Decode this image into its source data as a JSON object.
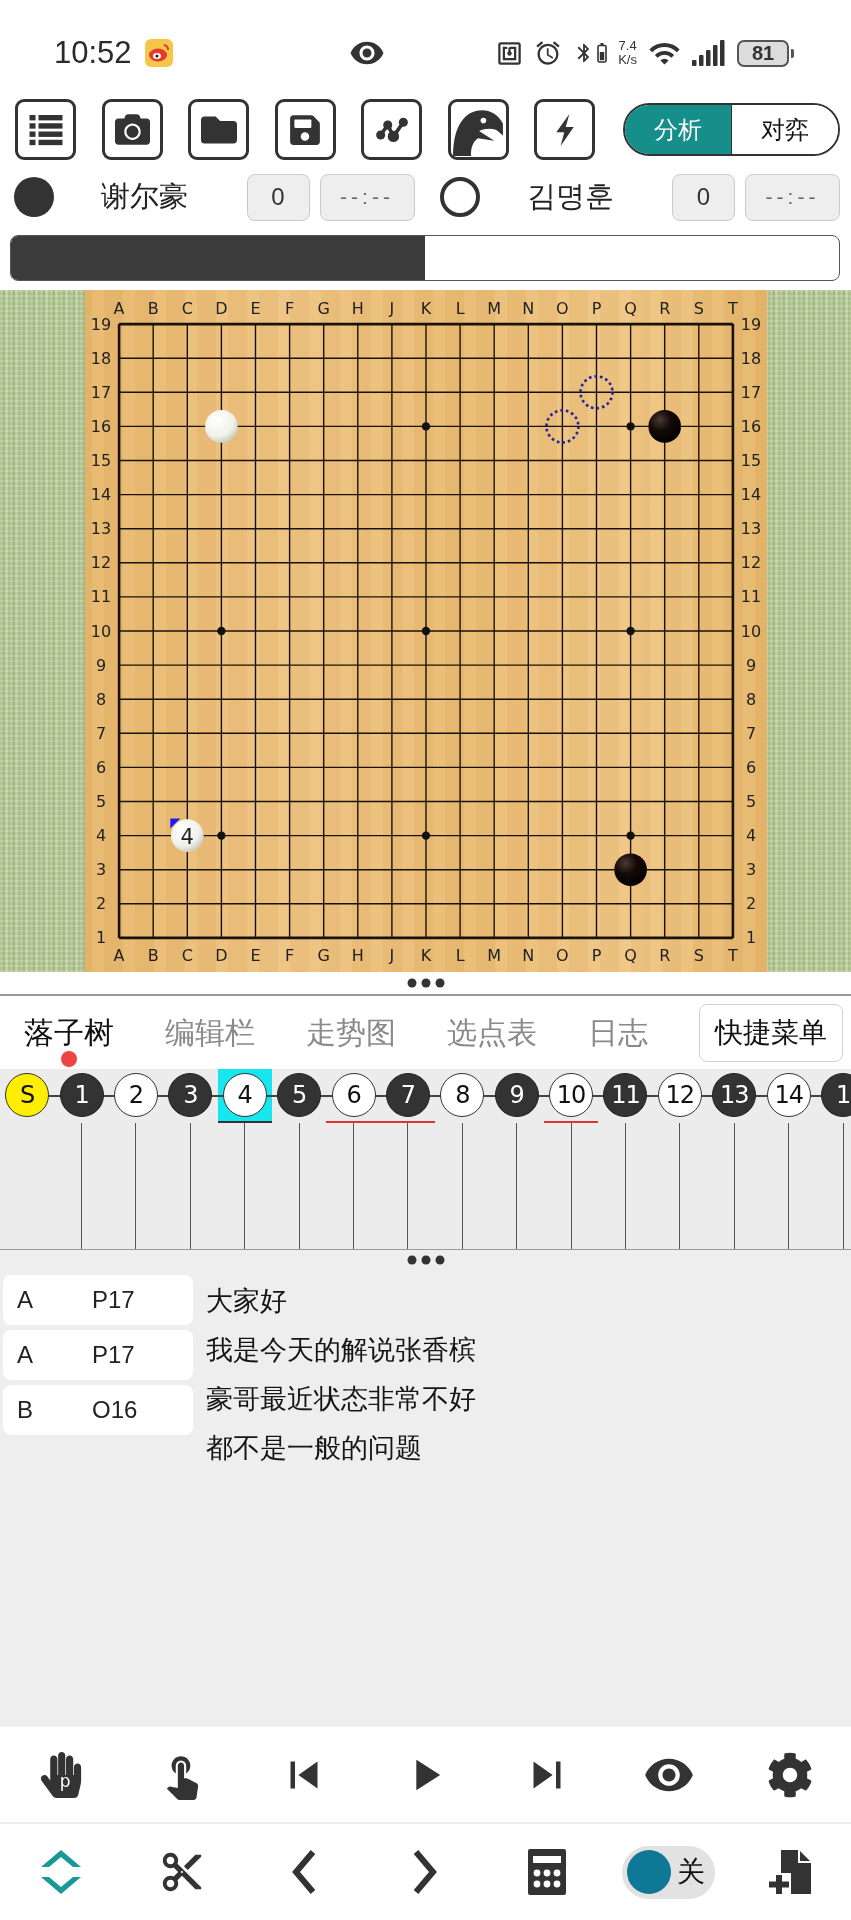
{
  "status_bar": {
    "time": "10:52",
    "network_speed": {
      "value": "7.4",
      "unit": "K/s"
    },
    "battery": "81"
  },
  "mode_switch": [
    {
      "label": "分析",
      "selected": true
    },
    {
      "label": "对弈",
      "selected": false
    }
  ],
  "players": [
    {
      "kind": "black",
      "name": "谢尔豪",
      "captures": "0",
      "clock": "--:--"
    },
    {
      "kind": "white",
      "name": "김명훈",
      "captures": "0",
      "clock": "--:--"
    }
  ],
  "win_rate_bar": {
    "level": 0.5
  },
  "board": {
    "columns_top": [
      "A",
      "B",
      "C",
      "D",
      "E",
      "F",
      "G",
      "H",
      "J",
      "K",
      "L",
      "M",
      "N",
      "O",
      "P",
      "Q",
      "R",
      "S",
      "T"
    ],
    "columns_bottom": [
      "A",
      "B",
      "C",
      "D",
      "E",
      "F",
      "G",
      "H",
      "J",
      "K",
      "L",
      "M",
      "N",
      "O",
      "P",
      "Q",
      "R",
      "S",
      "T"
    ],
    "rows": [
      {
        "left_label": "19",
        "right_label": "19",
        "points": [
          {
            "kind": "empty"
          },
          {
            "kind": "empty"
          },
          {
            "kind": "empty"
          },
          {
            "kind": "empty"
          },
          {
            "kind": "empty"
          },
          {
            "kind": "empty"
          },
          {
            "kind": "empty"
          },
          {
            "kind": "empty"
          },
          {
            "kind": "empty"
          },
          {
            "kind": "empty"
          },
          {
            "kind": "empty"
          },
          {
            "kind": "empty"
          },
          {
            "kind": "empty"
          },
          {
            "kind": "empty"
          },
          {
            "kind": "empty"
          },
          {
            "kind": "empty"
          },
          {
            "kind": "empty"
          },
          {
            "kind": "empty"
          },
          {
            "kind": "empty"
          }
        ]
      },
      {
        "left_label": "18",
        "right_label": "18",
        "points": [
          {
            "kind": "empty"
          },
          {
            "kind": "empty"
          },
          {
            "kind": "empty"
          },
          {
            "kind": "empty"
          },
          {
            "kind": "empty"
          },
          {
            "kind": "empty"
          },
          {
            "kind": "empty"
          },
          {
            "kind": "empty"
          },
          {
            "kind": "empty"
          },
          {
            "kind": "empty"
          },
          {
            "kind": "empty"
          },
          {
            "kind": "empty"
          },
          {
            "kind": "empty"
          },
          {
            "kind": "empty"
          },
          {
            "kind": "empty"
          },
          {
            "kind": "empty"
          },
          {
            "kind": "empty"
          },
          {
            "kind": "empty"
          },
          {
            "kind": "empty"
          }
        ]
      },
      {
        "left_label": "17",
        "right_label": "17",
        "points": [
          {
            "kind": "empty"
          },
          {
            "kind": "empty"
          },
          {
            "kind": "empty"
          },
          {
            "kind": "empty"
          },
          {
            "kind": "empty"
          },
          {
            "kind": "empty"
          },
          {
            "kind": "empty"
          },
          {
            "kind": "empty"
          },
          {
            "kind": "empty"
          },
          {
            "kind": "empty"
          },
          {
            "kind": "empty"
          },
          {
            "kind": "empty"
          },
          {
            "kind": "empty"
          },
          {
            "kind": "empty"
          },
          {
            "kind": "candidate"
          },
          {
            "kind": "empty"
          },
          {
            "kind": "empty"
          },
          {
            "kind": "empty"
          },
          {
            "kind": "empty"
          }
        ]
      },
      {
        "left_label": "16",
        "right_label": "16",
        "points": [
          {
            "kind": "empty"
          },
          {
            "kind": "empty"
          },
          {
            "kind": "empty"
          },
          {
            "kind": "white",
            "last_move": false
          },
          {
            "kind": "empty"
          },
          {
            "kind": "empty"
          },
          {
            "kind": "empty"
          },
          {
            "kind": "empty"
          },
          {
            "kind": "empty"
          },
          {
            "kind": "empty"
          },
          {
            "kind": "empty"
          },
          {
            "kind": "empty"
          },
          {
            "kind": "empty"
          },
          {
            "kind": "candidate"
          },
          {
            "kind": "empty"
          },
          {
            "kind": "empty"
          },
          {
            "kind": "black",
            "last_move": false
          },
          {
            "kind": "empty"
          },
          {
            "kind": "empty"
          }
        ]
      },
      {
        "left_label": "15",
        "right_label": "15",
        "points": [
          {
            "kind": "empty"
          },
          {
            "kind": "empty"
          },
          {
            "kind": "empty"
          },
          {
            "kind": "empty"
          },
          {
            "kind": "empty"
          },
          {
            "kind": "empty"
          },
          {
            "kind": "empty"
          },
          {
            "kind": "empty"
          },
          {
            "kind": "empty"
          },
          {
            "kind": "empty"
          },
          {
            "kind": "empty"
          },
          {
            "kind": "empty"
          },
          {
            "kind": "empty"
          },
          {
            "kind": "empty"
          },
          {
            "kind": "empty"
          },
          {
            "kind": "empty"
          },
          {
            "kind": "empty"
          },
          {
            "kind": "empty"
          },
          {
            "kind": "empty"
          }
        ]
      },
      {
        "left_label": "14",
        "right_label": "14",
        "points": [
          {
            "kind": "empty"
          },
          {
            "kind": "empty"
          },
          {
            "kind": "empty"
          },
          {
            "kind": "empty"
          },
          {
            "kind": "empty"
          },
          {
            "kind": "empty"
          },
          {
            "kind": "empty"
          },
          {
            "kind": "empty"
          },
          {
            "kind": "empty"
          },
          {
            "kind": "empty"
          },
          {
            "kind": "empty"
          },
          {
            "kind": "empty"
          },
          {
            "kind": "empty"
          },
          {
            "kind": "empty"
          },
          {
            "kind": "empty"
          },
          {
            "kind": "empty"
          },
          {
            "kind": "empty"
          },
          {
            "kind": "empty"
          },
          {
            "kind": "empty"
          }
        ]
      },
      {
        "left_label": "13",
        "right_label": "13",
        "points": [
          {
            "kind": "empty"
          },
          {
            "kind": "empty"
          },
          {
            "kind": "empty"
          },
          {
            "kind": "empty"
          },
          {
            "kind": "empty"
          },
          {
            "kind": "empty"
          },
          {
            "kind": "empty"
          },
          {
            "kind": "empty"
          },
          {
            "kind": "empty"
          },
          {
            "kind": "empty"
          },
          {
            "kind": "empty"
          },
          {
            "kind": "empty"
          },
          {
            "kind": "empty"
          },
          {
            "kind": "empty"
          },
          {
            "kind": "empty"
          },
          {
            "kind": "empty"
          },
          {
            "kind": "empty"
          },
          {
            "kind": "empty"
          },
          {
            "kind": "empty"
          }
        ]
      },
      {
        "left_label": "12",
        "right_label": "12",
        "points": [
          {
            "kind": "empty"
          },
          {
            "kind": "empty"
          },
          {
            "kind": "empty"
          },
          {
            "kind": "empty"
          },
          {
            "kind": "empty"
          },
          {
            "kind": "empty"
          },
          {
            "kind": "empty"
          },
          {
            "kind": "empty"
          },
          {
            "kind": "empty"
          },
          {
            "kind": "empty"
          },
          {
            "kind": "empty"
          },
          {
            "kind": "empty"
          },
          {
            "kind": "empty"
          },
          {
            "kind": "empty"
          },
          {
            "kind": "empty"
          },
          {
            "kind": "empty"
          },
          {
            "kind": "empty"
          },
          {
            "kind": "empty"
          },
          {
            "kind": "empty"
          }
        ]
      },
      {
        "left_label": "11",
        "right_label": "11",
        "points": [
          {
            "kind": "empty"
          },
          {
            "kind": "empty"
          },
          {
            "kind": "empty"
          },
          {
            "kind": "empty"
          },
          {
            "kind": "empty"
          },
          {
            "kind": "empty"
          },
          {
            "kind": "empty"
          },
          {
            "kind": "empty"
          },
          {
            "kind": "empty"
          },
          {
            "kind": "empty"
          },
          {
            "kind": "empty"
          },
          {
            "kind": "empty"
          },
          {
            "kind": "empty"
          },
          {
            "kind": "empty"
          },
          {
            "kind": "empty"
          },
          {
            "kind": "empty"
          },
          {
            "kind": "empty"
          },
          {
            "kind": "empty"
          },
          {
            "kind": "empty"
          }
        ]
      },
      {
        "left_label": "10",
        "right_label": "10",
        "points": [
          {
            "kind": "empty"
          },
          {
            "kind": "empty"
          },
          {
            "kind": "empty"
          },
          {
            "kind": "empty"
          },
          {
            "kind": "empty"
          },
          {
            "kind": "empty"
          },
          {
            "kind": "empty"
          },
          {
            "kind": "empty"
          },
          {
            "kind": "empty"
          },
          {
            "kind": "empty"
          },
          {
            "kind": "empty"
          },
          {
            "kind": "empty"
          },
          {
            "kind": "empty"
          },
          {
            "kind": "empty"
          },
          {
            "kind": "empty"
          },
          {
            "kind": "empty"
          },
          {
            "kind": "empty"
          },
          {
            "kind": "empty"
          },
          {
            "kind": "empty"
          }
        ]
      },
      {
        "left_label": "9",
        "right_label": "9",
        "points": [
          {
            "kind": "empty"
          },
          {
            "kind": "empty"
          },
          {
            "kind": "empty"
          },
          {
            "kind": "empty"
          },
          {
            "kind": "empty"
          },
          {
            "kind": "empty"
          },
          {
            "kind": "empty"
          },
          {
            "kind": "empty"
          },
          {
            "kind": "empty"
          },
          {
            "kind": "empty"
          },
          {
            "kind": "empty"
          },
          {
            "kind": "empty"
          },
          {
            "kind": "empty"
          },
          {
            "kind": "empty"
          },
          {
            "kind": "empty"
          },
          {
            "kind": "empty"
          },
          {
            "kind": "empty"
          },
          {
            "kind": "empty"
          },
          {
            "kind": "empty"
          }
        ]
      },
      {
        "left_label": "8",
        "right_label": "8",
        "points": [
          {
            "kind": "empty"
          },
          {
            "kind": "empty"
          },
          {
            "kind": "empty"
          },
          {
            "kind": "empty"
          },
          {
            "kind": "empty"
          },
          {
            "kind": "empty"
          },
          {
            "kind": "empty"
          },
          {
            "kind": "empty"
          },
          {
            "kind": "empty"
          },
          {
            "kind": "empty"
          },
          {
            "kind": "empty"
          },
          {
            "kind": "empty"
          },
          {
            "kind": "empty"
          },
          {
            "kind": "empty"
          },
          {
            "kind": "empty"
          },
          {
            "kind": "empty"
          },
          {
            "kind": "empty"
          },
          {
            "kind": "empty"
          },
          {
            "kind": "empty"
          }
        ]
      },
      {
        "left_label": "7",
        "right_label": "7",
        "points": [
          {
            "kind": "empty"
          },
          {
            "kind": "empty"
          },
          {
            "kind": "empty"
          },
          {
            "kind": "empty"
          },
          {
            "kind": "empty"
          },
          {
            "kind": "empty"
          },
          {
            "kind": "empty"
          },
          {
            "kind": "empty"
          },
          {
            "kind": "empty"
          },
          {
            "kind": "empty"
          },
          {
            "kind": "empty"
          },
          {
            "kind": "empty"
          },
          {
            "kind": "empty"
          },
          {
            "kind": "empty"
          },
          {
            "kind": "empty"
          },
          {
            "kind": "empty"
          },
          {
            "kind": "empty"
          },
          {
            "kind": "empty"
          },
          {
            "kind": "empty"
          }
        ]
      },
      {
        "left_label": "6",
        "right_label": "6",
        "points": [
          {
            "kind": "empty"
          },
          {
            "kind": "empty"
          },
          {
            "kind": "empty"
          },
          {
            "kind": "empty"
          },
          {
            "kind": "empty"
          },
          {
            "kind": "empty"
          },
          {
            "kind": "empty"
          },
          {
            "kind": "empty"
          },
          {
            "kind": "empty"
          },
          {
            "kind": "empty"
          },
          {
            "kind": "empty"
          },
          {
            "kind": "empty"
          },
          {
            "kind": "empty"
          },
          {
            "kind": "empty"
          },
          {
            "kind": "empty"
          },
          {
            "kind": "empty"
          },
          {
            "kind": "empty"
          },
          {
            "kind": "empty"
          },
          {
            "kind": "empty"
          }
        ]
      },
      {
        "left_label": "5",
        "right_label": "5",
        "points": [
          {
            "kind": "empty"
          },
          {
            "kind": "empty"
          },
          {
            "kind": "empty"
          },
          {
            "kind": "empty"
          },
          {
            "kind": "empty"
          },
          {
            "kind": "empty"
          },
          {
            "kind": "empty"
          },
          {
            "kind": "empty"
          },
          {
            "kind": "empty"
          },
          {
            "kind": "empty"
          },
          {
            "kind": "empty"
          },
          {
            "kind": "empty"
          },
          {
            "kind": "empty"
          },
          {
            "kind": "empty"
          },
          {
            "kind": "empty"
          },
          {
            "kind": "empty"
          },
          {
            "kind": "empty"
          },
          {
            "kind": "empty"
          },
          {
            "kind": "empty"
          }
        ]
      },
      {
        "left_label": "4",
        "right_label": "4",
        "points": [
          {
            "kind": "empty"
          },
          {
            "kind": "empty"
          },
          {
            "kind": "white",
            "label": "4",
            "last_move": true
          },
          {
            "kind": "empty"
          },
          {
            "kind": "empty"
          },
          {
            "kind": "empty"
          },
          {
            "kind": "empty"
          },
          {
            "kind": "empty"
          },
          {
            "kind": "empty"
          },
          {
            "kind": "empty"
          },
          {
            "kind": "empty"
          },
          {
            "kind": "empty"
          },
          {
            "kind": "empty"
          },
          {
            "kind": "empty"
          },
          {
            "kind": "empty"
          },
          {
            "kind": "empty"
          },
          {
            "kind": "empty"
          },
          {
            "kind": "empty"
          },
          {
            "kind": "empty"
          }
        ]
      },
      {
        "left_label": "3",
        "right_label": "3",
        "points": [
          {
            "kind": "empty"
          },
          {
            "kind": "empty"
          },
          {
            "kind": "empty"
          },
          {
            "kind": "empty"
          },
          {
            "kind": "empty"
          },
          {
            "kind": "empty"
          },
          {
            "kind": "empty"
          },
          {
            "kind": "empty"
          },
          {
            "kind": "empty"
          },
          {
            "kind": "empty"
          },
          {
            "kind": "empty"
          },
          {
            "kind": "empty"
          },
          {
            "kind": "empty"
          },
          {
            "kind": "empty"
          },
          {
            "kind": "empty"
          },
          {
            "kind": "black",
            "last_move": false
          },
          {
            "kind": "empty"
          },
          {
            "kind": "empty"
          },
          {
            "kind": "empty"
          }
        ]
      },
      {
        "left_label": "2",
        "right_label": "2",
        "points": [
          {
            "kind": "empty"
          },
          {
            "kind": "empty"
          },
          {
            "kind": "empty"
          },
          {
            "kind": "empty"
          },
          {
            "kind": "empty"
          },
          {
            "kind": "empty"
          },
          {
            "kind": "empty"
          },
          {
            "kind": "empty"
          },
          {
            "kind": "empty"
          },
          {
            "kind": "empty"
          },
          {
            "kind": "empty"
          },
          {
            "kind": "empty"
          },
          {
            "kind": "empty"
          },
          {
            "kind": "empty"
          },
          {
            "kind": "empty"
          },
          {
            "kind": "empty"
          },
          {
            "kind": "empty"
          },
          {
            "kind": "empty"
          },
          {
            "kind": "empty"
          }
        ]
      },
      {
        "left_label": "1",
        "right_label": "1",
        "points": [
          {
            "kind": "empty"
          },
          {
            "kind": "empty"
          },
          {
            "kind": "empty"
          },
          {
            "kind": "empty"
          },
          {
            "kind": "empty"
          },
          {
            "kind": "empty"
          },
          {
            "kind": "empty"
          },
          {
            "kind": "empty"
          },
          {
            "kind": "empty"
          },
          {
            "kind": "empty"
          },
          {
            "kind": "empty"
          },
          {
            "kind": "empty"
          },
          {
            "kind": "empty"
          },
          {
            "kind": "empty"
          },
          {
            "kind": "empty"
          },
          {
            "kind": "empty"
          },
          {
            "kind": "empty"
          },
          {
            "kind": "empty"
          },
          {
            "kind": "empty"
          }
        ]
      }
    ]
  },
  "tabs": [
    {
      "label": "落子树",
      "selected": true,
      "badge": true
    },
    {
      "label": "编辑栏",
      "selected": false,
      "badge": false
    },
    {
      "label": "走势图",
      "selected": false,
      "badge": false
    },
    {
      "label": "选点表",
      "selected": false,
      "badge": false
    },
    {
      "label": "日志",
      "selected": false,
      "badge": false
    }
  ],
  "quick_menu_button": "快捷菜单",
  "move_tree": {
    "nodes": [
      {
        "label": "S",
        "kind": "start",
        "selected": false,
        "marked": false
      },
      {
        "label": "1",
        "kind": "black",
        "selected": false,
        "marked": false
      },
      {
        "label": "2",
        "kind": "white",
        "selected": false,
        "marked": false
      },
      {
        "label": "3",
        "kind": "black",
        "selected": false,
        "marked": false
      },
      {
        "label": "4",
        "kind": "white",
        "selected": true,
        "marked": false
      },
      {
        "label": "5",
        "kind": "black",
        "selected": false,
        "marked": false
      },
      {
        "label": "6",
        "kind": "white",
        "selected": false,
        "marked": true
      },
      {
        "label": "7",
        "kind": "black",
        "selected": false,
        "marked": true
      },
      {
        "label": "8",
        "kind": "white",
        "selected": false,
        "marked": false
      },
      {
        "label": "9",
        "kind": "black",
        "selected": false,
        "marked": false
      },
      {
        "label": "10",
        "kind": "white",
        "selected": false,
        "marked": true
      },
      {
        "label": "11",
        "kind": "black",
        "selected": false,
        "marked": false
      },
      {
        "label": "12",
        "kind": "white",
        "selected": false,
        "marked": false
      },
      {
        "label": "13",
        "kind": "black",
        "selected": false,
        "marked": false
      },
      {
        "label": "14",
        "kind": "white",
        "selected": false,
        "marked": false
      },
      {
        "label": "1",
        "kind": "black",
        "selected": false,
        "marked": false
      }
    ]
  },
  "variations": [
    {
      "group": "A",
      "point": "P17"
    },
    {
      "group": "A",
      "point": "P17"
    },
    {
      "group": "B",
      "point": "O16"
    }
  ],
  "comment_lines": [
    "大家好",
    "我是今天的解说张香槟",
    "豪哥最近状态非常不好",
    "都不是一般的问题"
  ],
  "controls": {
    "hand_letter": "p",
    "toggle": {
      "label": "关",
      "on": false
    }
  }
}
